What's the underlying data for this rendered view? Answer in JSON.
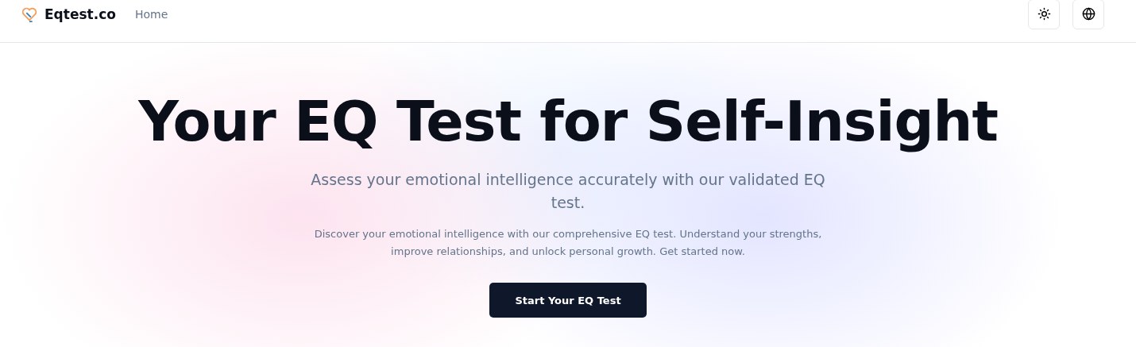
{
  "header": {
    "brand": "Eqtest.co",
    "nav": [
      {
        "label": "Home"
      }
    ]
  },
  "hero": {
    "title": "Your EQ Test for Self-Insight",
    "subtitle": "Assess your emotional intelligence accurately with our validated EQ test.",
    "description": "Discover your emotional intelligence with our comprehensive EQ test. Understand your strengths, improve relationships, and unlock personal growth. Get started now.",
    "button": "Start Your EQ Test"
  }
}
